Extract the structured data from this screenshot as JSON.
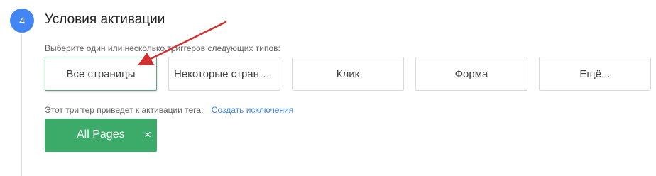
{
  "step": {
    "number": "4",
    "title": "Условия активации"
  },
  "instruction": "Выберите один или несколько триггеров следующих типов:",
  "trigger_types": [
    {
      "label": "Все страницы",
      "selected": true
    },
    {
      "label": "Некоторые страницы",
      "selected": false
    },
    {
      "label": "Клик",
      "selected": false
    },
    {
      "label": "Форма",
      "selected": false
    },
    {
      "label": "Ещё...",
      "selected": false
    }
  ],
  "activation": {
    "text": "Этот триггер приведет к активации тега:",
    "exceptions_link": "Создать исключения"
  },
  "chip": {
    "label": "All Pages",
    "close_symbol": "×"
  },
  "colors": {
    "step_circle": "#4285f4",
    "link": "#4285f4",
    "chip": "#3cab6a",
    "annotation_arrow": "#d32f2f"
  },
  "icons": {
    "chip_close": "close-icon",
    "annotation": "red-arrow-icon"
  }
}
